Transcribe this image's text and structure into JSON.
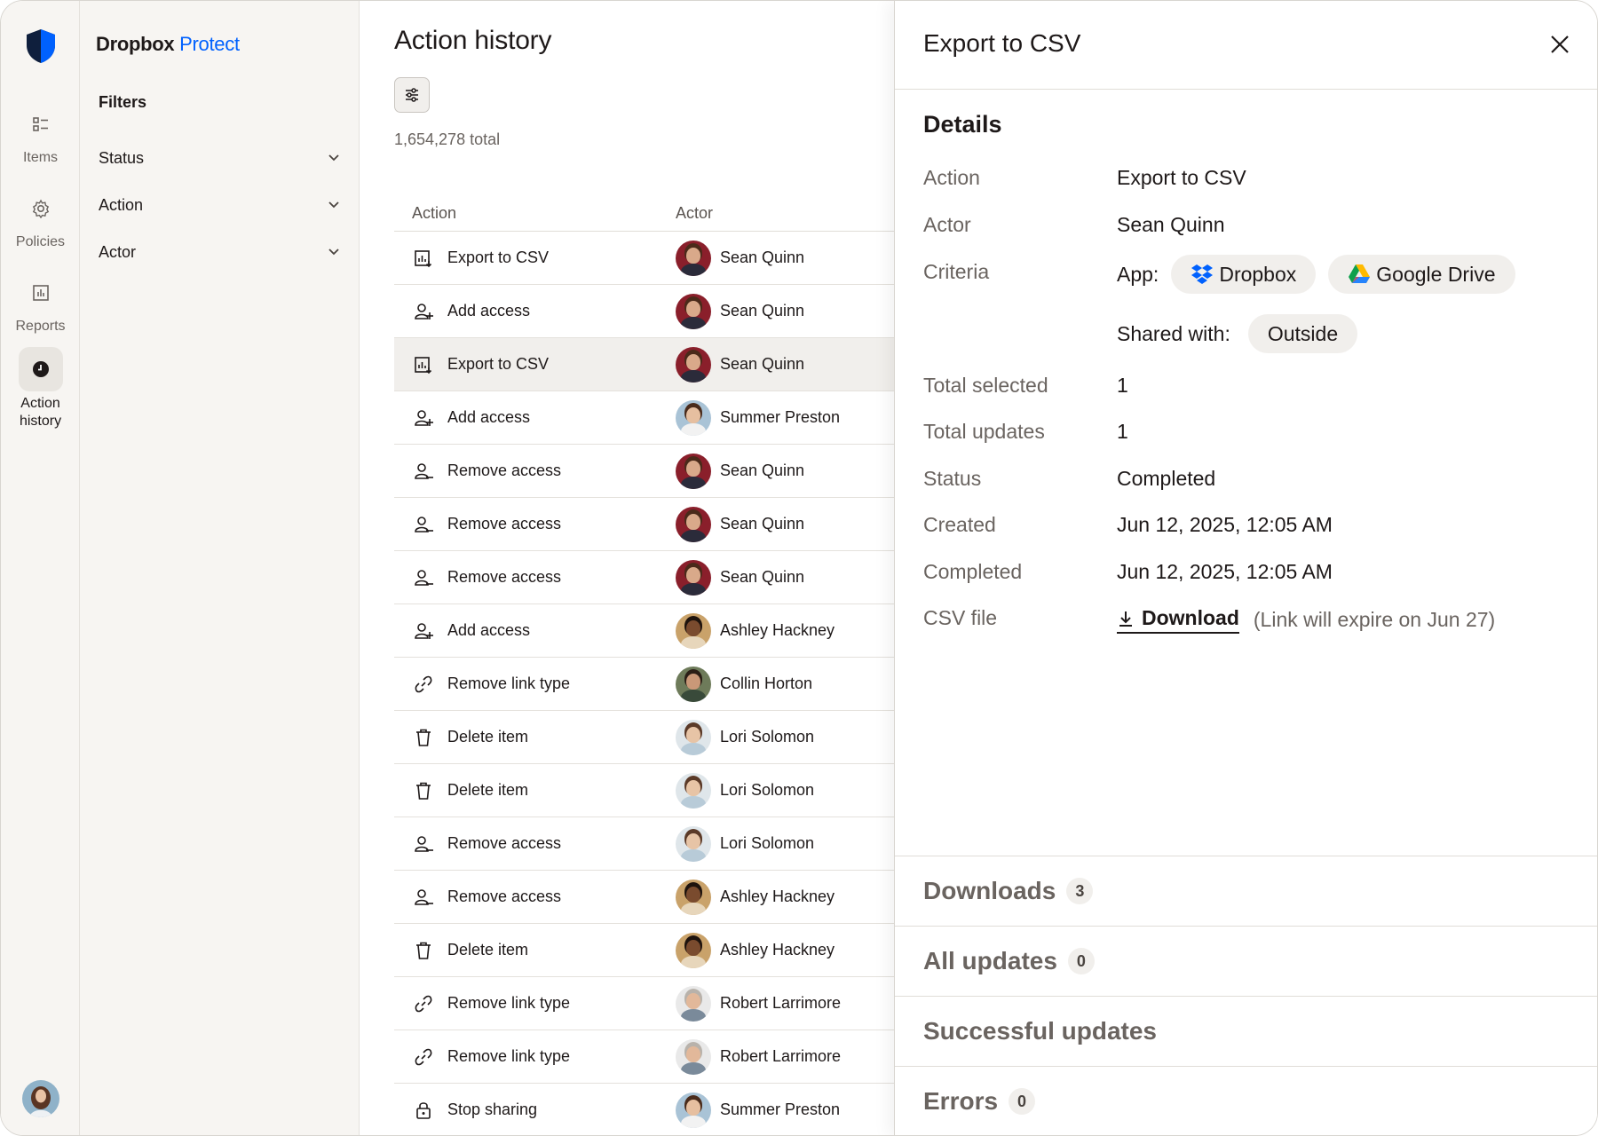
{
  "brand": {
    "name": "Dropbox",
    "product": "Protect"
  },
  "rail": {
    "items": [
      {
        "label": "Items",
        "icon": "items-icon"
      },
      {
        "label": "Policies",
        "icon": "policies-icon"
      },
      {
        "label": "Reports",
        "icon": "reports-icon"
      },
      {
        "label": "Action history",
        "icon": "clock-icon",
        "active": true
      }
    ]
  },
  "filters": {
    "title": "Filters",
    "items": [
      {
        "label": "Status"
      },
      {
        "label": "Action"
      },
      {
        "label": "Actor"
      }
    ]
  },
  "main": {
    "title": "Action history",
    "total": "1,654,278 total",
    "columns": {
      "action": "Action",
      "actor": "Actor"
    },
    "rows": [
      {
        "action": "Export to CSV",
        "icon": "export-icon",
        "actor": "Sean Quinn",
        "avatar": "sq"
      },
      {
        "action": "Add access",
        "icon": "add-access-icon",
        "actor": "Sean Quinn",
        "avatar": "sq"
      },
      {
        "action": "Export to CSV",
        "icon": "export-icon",
        "actor": "Sean Quinn",
        "avatar": "sq",
        "hover": true
      },
      {
        "action": "Add access",
        "icon": "add-access-icon",
        "actor": "Summer Preston",
        "avatar": "sp"
      },
      {
        "action": "Remove access",
        "icon": "remove-access-icon",
        "actor": "Sean Quinn",
        "avatar": "sq"
      },
      {
        "action": "Remove access",
        "icon": "remove-access-icon",
        "actor": "Sean Quinn",
        "avatar": "sq"
      },
      {
        "action": "Remove access",
        "icon": "remove-access-icon",
        "actor": "Sean Quinn",
        "avatar": "sq"
      },
      {
        "action": "Add access",
        "icon": "add-access-icon",
        "actor": "Ashley Hackney",
        "avatar": "ah"
      },
      {
        "action": "Remove link type",
        "icon": "link-icon",
        "actor": "Collin Horton",
        "avatar": "ch"
      },
      {
        "action": "Delete item",
        "icon": "trash-icon",
        "actor": "Lori Solomon",
        "avatar": "ls"
      },
      {
        "action": "Delete item",
        "icon": "trash-icon",
        "actor": "Lori Solomon",
        "avatar": "ls"
      },
      {
        "action": "Remove access",
        "icon": "remove-access-icon",
        "actor": "Lori Solomon",
        "avatar": "ls"
      },
      {
        "action": "Remove access",
        "icon": "remove-access-icon",
        "actor": "Ashley Hackney",
        "avatar": "ah"
      },
      {
        "action": "Delete item",
        "icon": "trash-icon",
        "actor": "Ashley Hackney",
        "avatar": "ah"
      },
      {
        "action": "Remove link type",
        "icon": "link-icon",
        "actor": "Robert Larrimore",
        "avatar": "rl"
      },
      {
        "action": "Remove link type",
        "icon": "link-icon",
        "actor": "Robert Larrimore",
        "avatar": "rl"
      },
      {
        "action": "Stop sharing",
        "icon": "lock-icon",
        "actor": "Summer Preston",
        "avatar": "sp"
      }
    ]
  },
  "drawer": {
    "title": "Export to CSV",
    "section": "Details",
    "labels": {
      "action": "Action",
      "actor": "Actor",
      "criteria": "Criteria",
      "total_selected": "Total selected",
      "total_updates": "Total updates",
      "status": "Status",
      "created": "Created",
      "completed": "Completed",
      "csv_file": "CSV file"
    },
    "values": {
      "action": "Export to CSV",
      "actor": "Sean Quinn",
      "app_label": "App:",
      "app_1": "Dropbox",
      "app_2": "Google Drive",
      "shared_label": "Shared with:",
      "shared_value": "Outside",
      "total_selected": "1",
      "total_updates": "1",
      "status": "Completed",
      "created": "Jun 12, 2025, 12:05 AM",
      "completed": "Jun 12, 2025, 12:05 AM",
      "download": "Download",
      "expiry_note": "(Link will expire on Jun 27)"
    },
    "sections": [
      {
        "label": "Downloads",
        "count": "3"
      },
      {
        "label": "All updates",
        "count": "0"
      },
      {
        "label": "Successful updates"
      },
      {
        "label": "Errors",
        "count": "0"
      }
    ]
  },
  "colors": {
    "accent": "#0061fe",
    "text": "#1e1919",
    "muted": "#6a6460",
    "surface": "#f7f5f2"
  }
}
